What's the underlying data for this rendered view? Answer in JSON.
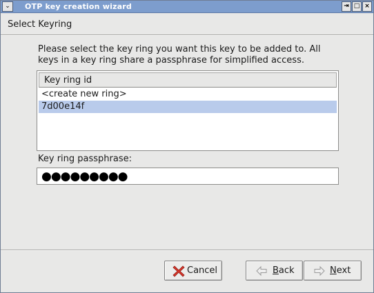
{
  "window": {
    "title": "OTP key creation wizard",
    "menu_glyph": "⌄",
    "controls": [
      "⇥",
      "□",
      "×"
    ]
  },
  "header": {
    "title": "Select Keyring"
  },
  "description": "Please select the key ring you want this key to be added to. All keys in a key ring share a passphrase for simplified access.",
  "keyring_list": {
    "column_header": "Key ring id",
    "items": [
      "<create new ring>",
      "7d00e14f"
    ],
    "selected_index": 1
  },
  "passphrase": {
    "label": "Key ring passphrase:",
    "masked_value": "●●●●●●●●●"
  },
  "buttons": {
    "cancel": {
      "label_underlined": "",
      "label_rest": "Cancel",
      "icon": "cancel-x-icon"
    },
    "back": {
      "label_underlined": "B",
      "label_rest": "ack",
      "icon": "back-arrow-icon"
    },
    "next": {
      "label_underlined": "N",
      "label_rest": "ext",
      "icon": "next-arrow-icon"
    }
  },
  "colors": {
    "titlebar": "#7d9dcd",
    "selection": "#b9cbeb",
    "cancel_icon": "#d9362b"
  }
}
